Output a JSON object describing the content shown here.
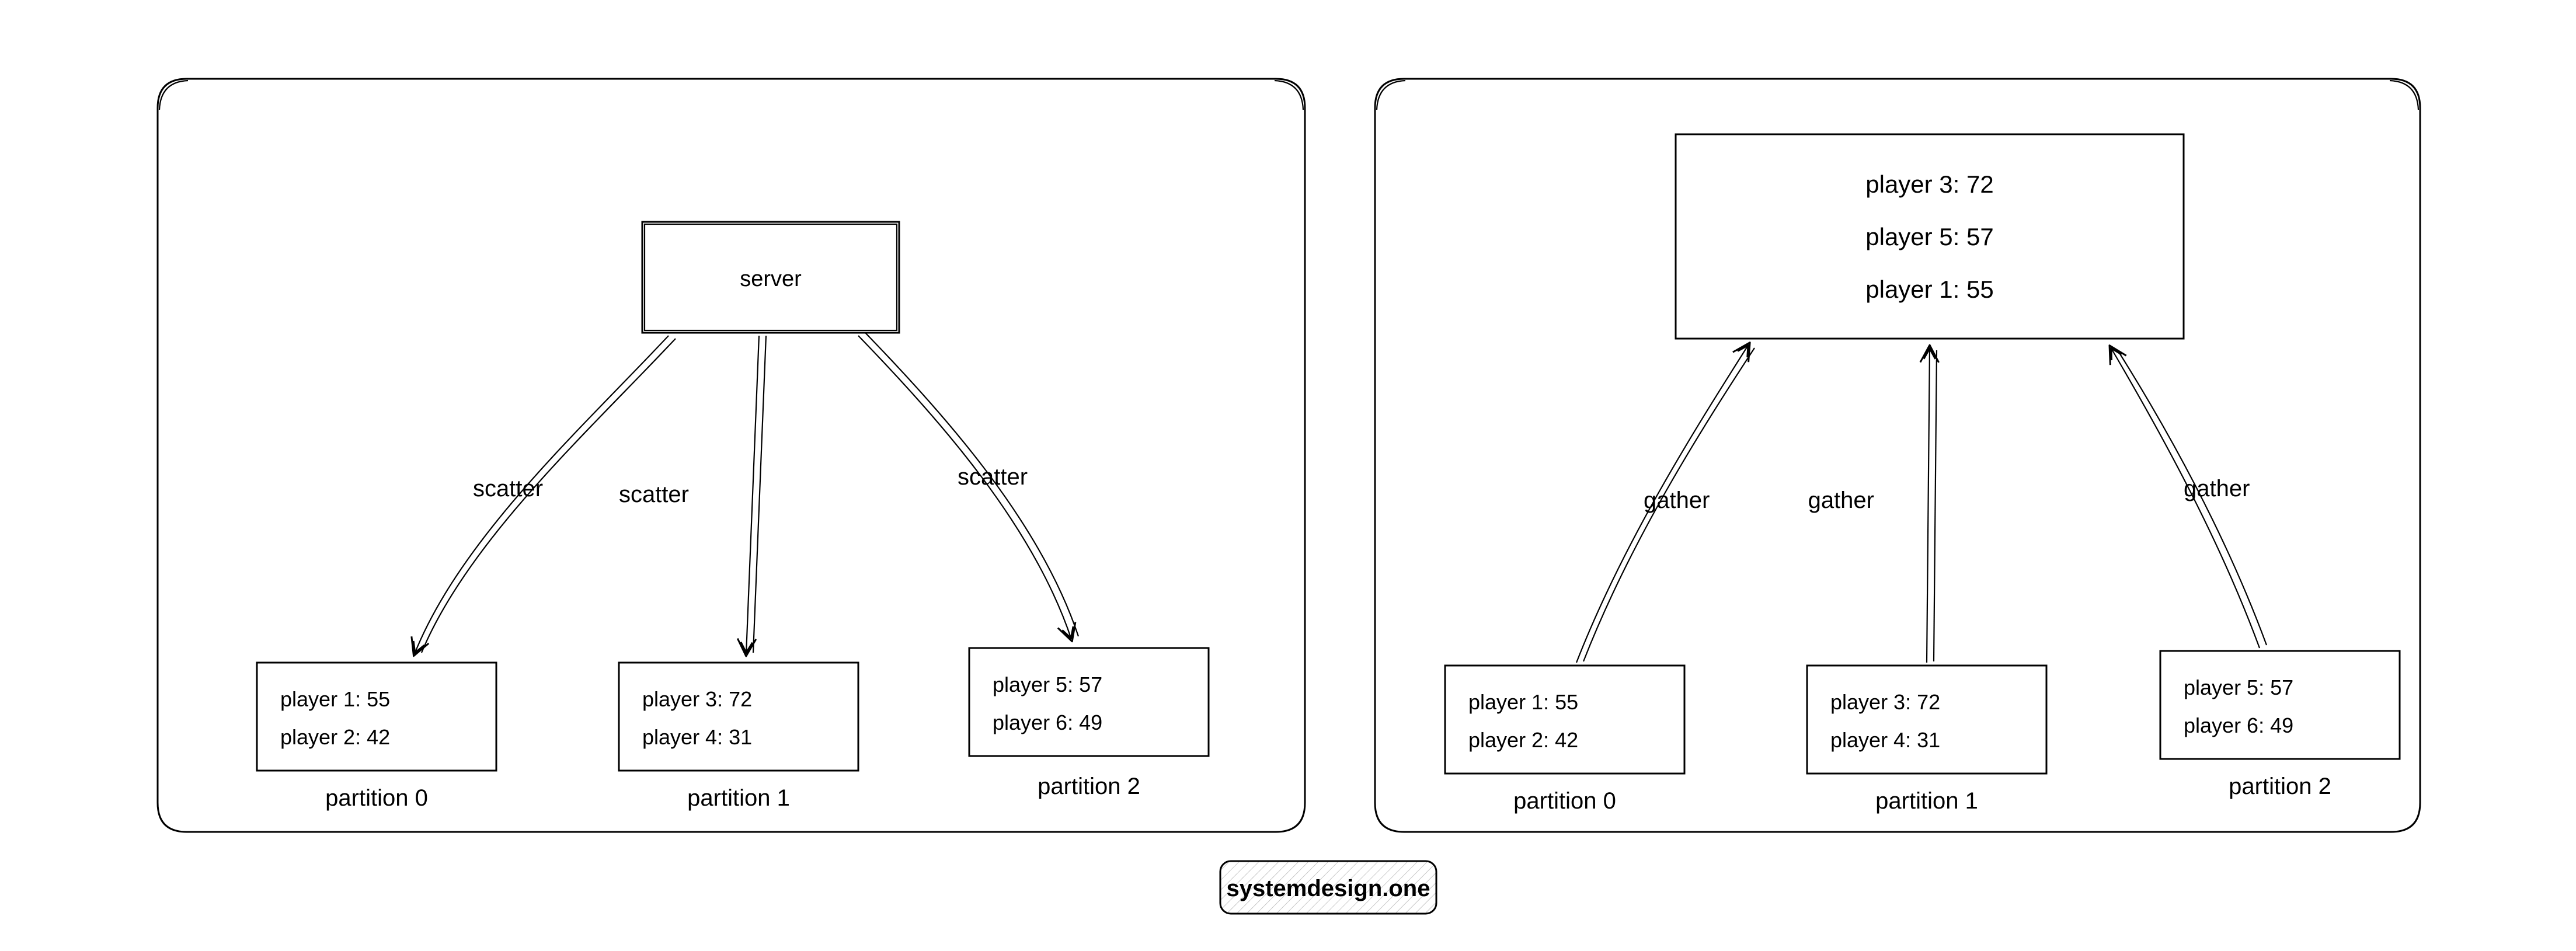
{
  "watermark": "systemdesign.one",
  "left": {
    "server_label": "server",
    "arrows": {
      "a0": "scatter",
      "a1": "scatter",
      "a2": "scatter"
    },
    "partitions": [
      {
        "label": "partition 0",
        "lines": [
          "player 1: 55",
          "player 2: 42"
        ]
      },
      {
        "label": "partition 1",
        "lines": [
          "player 3: 72",
          "player 4: 31"
        ]
      },
      {
        "label": "partition 2",
        "lines": [
          "player 5: 57",
          "player 6: 49"
        ]
      }
    ]
  },
  "right": {
    "result_lines": [
      "player 3: 72",
      "player 5: 57",
      "player 1: 55"
    ],
    "arrows": {
      "a0": "gather",
      "a1": "gather",
      "a2": "gather"
    },
    "partitions": [
      {
        "label": "partition 0",
        "lines": [
          "player 1: 55",
          "player 2: 42"
        ]
      },
      {
        "label": "partition 1",
        "lines": [
          "player 3: 72",
          "player 4: 31"
        ]
      },
      {
        "label": "partition 2",
        "lines": [
          "player 5: 57",
          "player 6: 49"
        ]
      }
    ]
  }
}
